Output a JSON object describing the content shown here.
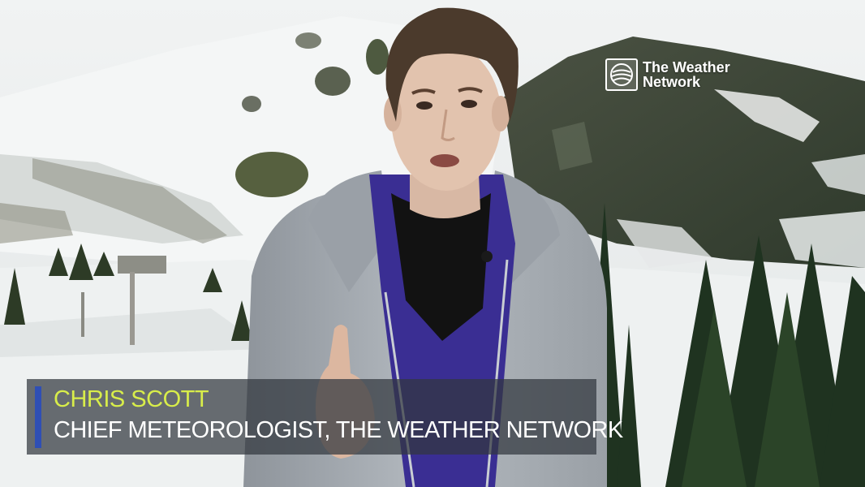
{
  "colors": {
    "accent_bar": "#2f4fb5",
    "name_text": "#d8ed4a",
    "title_text": "#ffffff",
    "jacket": "#a4aab1",
    "fleece": "#3a2e93",
    "sky": "#e9eced"
  },
  "brand": {
    "logo_icon": "weather-network-globe-icon",
    "line1": "The Weather",
    "line2": "Network"
  },
  "lower_third": {
    "name": "CHRIS SCOTT",
    "title": "CHIEF METEOROLOGIST, THE WEATHER NETWORK"
  }
}
